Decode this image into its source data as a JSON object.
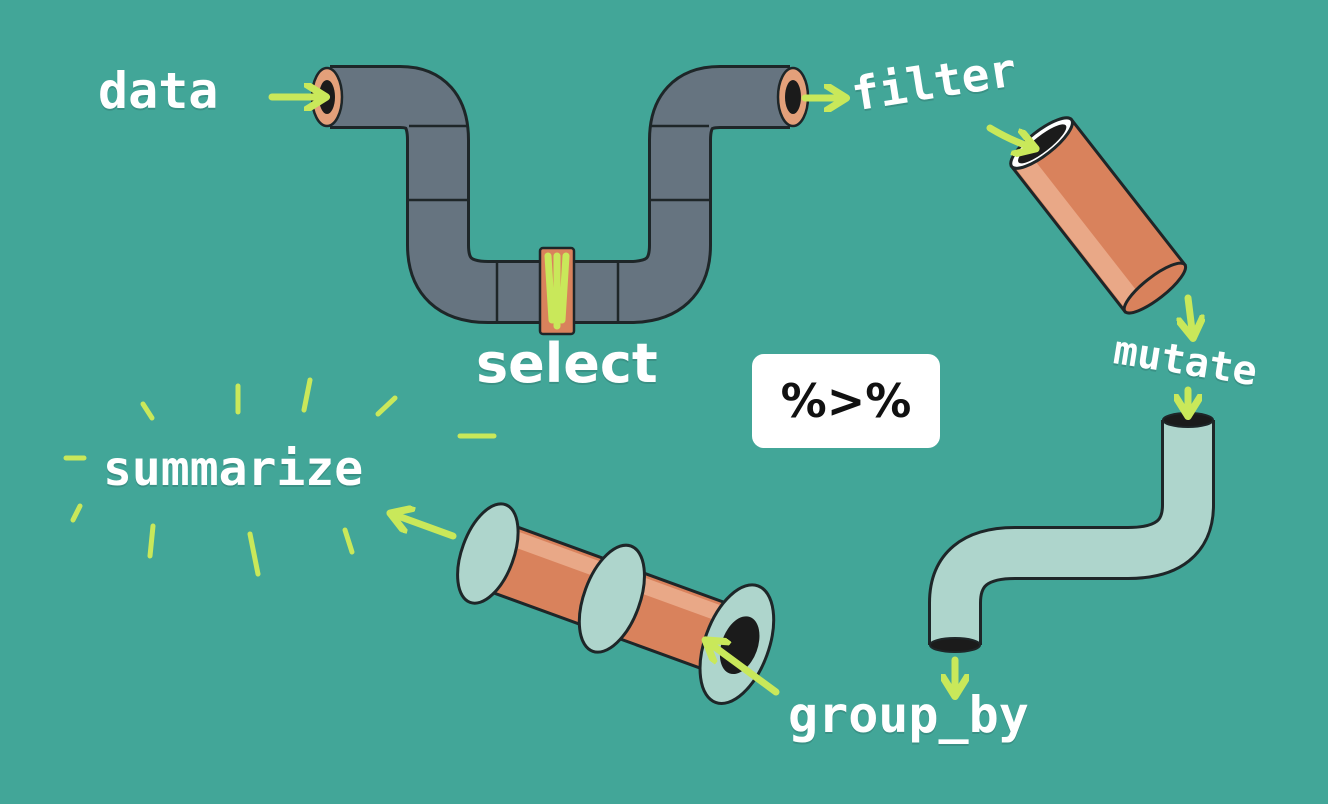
{
  "labels": {
    "data": "data",
    "filter": "filter",
    "mutate": "mutate",
    "group_by": "group_by",
    "summarize": "summarize",
    "select": "select"
  },
  "operator": "%>%",
  "colors": {
    "background": "#42a698",
    "arrow": "#c9e85a",
    "pipe_gray": "#667480",
    "pipe_orange": "#d9825c",
    "pipe_mint": "#aed5cc",
    "outline": "#1e2628",
    "badge": "#ffffff"
  }
}
